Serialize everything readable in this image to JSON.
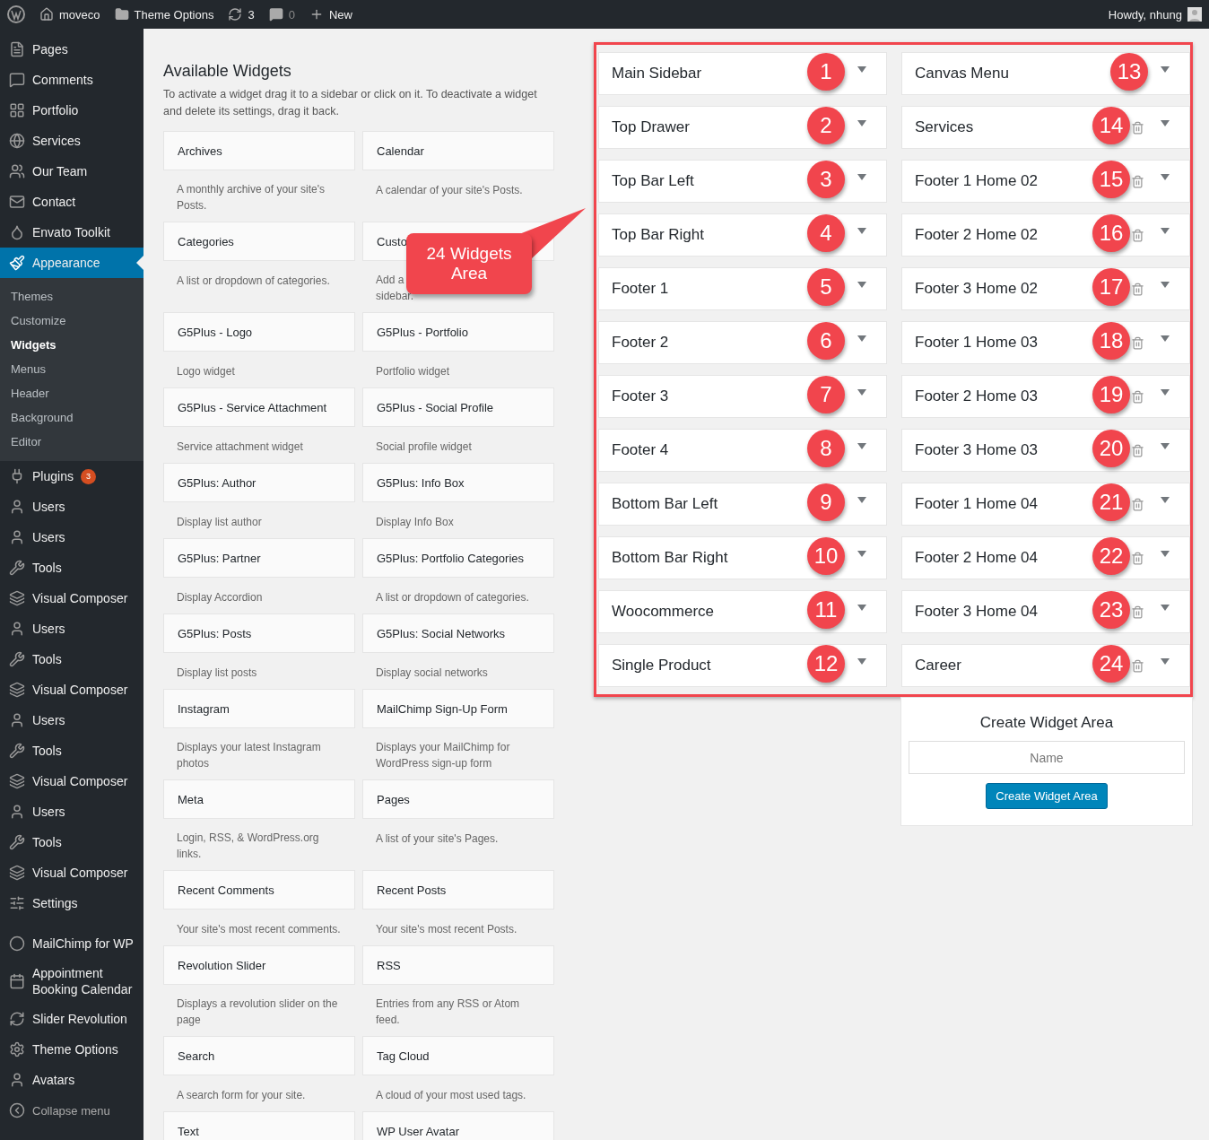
{
  "admin_bar": {
    "site": "moveco",
    "theme_options": "Theme Options",
    "updates": "3",
    "comments": "0",
    "new": "New",
    "greeting": "Howdy, nhung"
  },
  "sidebar": {
    "items": [
      {
        "label": "Pages",
        "selected": false
      },
      {
        "label": "Comments",
        "selected": false
      },
      {
        "label": "Portfolio",
        "selected": false
      },
      {
        "label": "Services",
        "selected": false
      },
      {
        "label": "Our Team",
        "selected": false
      },
      {
        "label": "Contact",
        "selected": false
      },
      {
        "label": "Envato Toolkit",
        "selected": false
      },
      {
        "label": "Appearance",
        "selected": true,
        "children": [
          {
            "label": "Themes",
            "selected": false
          },
          {
            "label": "Customize",
            "selected": false
          },
          {
            "label": "Widgets",
            "selected": true
          },
          {
            "label": "Menus",
            "selected": false
          },
          {
            "label": "Header",
            "selected": false
          },
          {
            "label": "Background",
            "selected": false
          },
          {
            "label": "Editor",
            "selected": false
          }
        ]
      },
      {
        "label": "Plugins",
        "selected": false,
        "badge": "3"
      },
      {
        "label": "Users",
        "selected": false
      },
      {
        "label": "Users",
        "selected": false
      },
      {
        "label": "Tools",
        "selected": false
      },
      {
        "label": "Visual Composer",
        "selected": false
      },
      {
        "label": "Users",
        "selected": false
      },
      {
        "label": "Tools",
        "selected": false
      },
      {
        "label": "Visual Composer",
        "selected": false
      },
      {
        "label": "Users",
        "selected": false
      },
      {
        "label": "Tools",
        "selected": false
      },
      {
        "label": "Visual Composer",
        "selected": false
      },
      {
        "label": "Users",
        "selected": false
      },
      {
        "label": "Tools",
        "selected": false
      },
      {
        "label": "Visual Composer",
        "selected": false
      },
      {
        "label": "Settings",
        "selected": false
      },
      {
        "label": "MailChimp for WP",
        "selected": false,
        "separator_before": true
      },
      {
        "label": "Appointment Booking Calendar",
        "selected": false
      },
      {
        "label": "Slider Revolution",
        "selected": false
      },
      {
        "label": "Theme Options",
        "selected": false
      },
      {
        "label": "Avatars",
        "selected": false
      }
    ],
    "collapse": "Collapse menu"
  },
  "available_widgets": {
    "title": "Available Widgets",
    "description": "To activate a widget drag it to a sidebar or click on it. To deactivate a widget and delete its settings, drag it back.",
    "widgets": [
      {
        "name": "Archives",
        "description": "A monthly archive of your site's Posts."
      },
      {
        "name": "Calendar",
        "description": "A calendar of your site's Posts."
      },
      {
        "name": "Categories",
        "description": "A list or dropdown of categories."
      },
      {
        "name": "Custo",
        "description": "Add a\nsidebar."
      },
      {
        "name": "G5Plus - Logo",
        "description": "Logo widget"
      },
      {
        "name": "G5Plus - Portfolio",
        "description": "Portfolio widget"
      },
      {
        "name": "G5Plus - Service Attachment",
        "description": "Service attachment widget"
      },
      {
        "name": "G5Plus - Social Profile",
        "description": "Social profile widget"
      },
      {
        "name": "G5Plus: Author",
        "description": "Display list author"
      },
      {
        "name": "G5Plus: Info Box",
        "description": "Display Info Box"
      },
      {
        "name": "G5Plus: Partner",
        "description": "Display Accordion"
      },
      {
        "name": "G5Plus: Portfolio Categories",
        "description": "A list or dropdown of categories."
      },
      {
        "name": "G5Plus: Posts",
        "description": "Display list posts"
      },
      {
        "name": "G5Plus: Social Networks",
        "description": "Display social networks"
      },
      {
        "name": "Instagram",
        "description": "Displays your latest Instagram photos"
      },
      {
        "name": "MailChimp Sign-Up Form",
        "description": "Displays your MailChimp for WordPress sign-up form"
      },
      {
        "name": "Meta",
        "description": "Login, RSS, & WordPress.org links."
      },
      {
        "name": "Pages",
        "description": "A list of your site's Pages."
      },
      {
        "name": "Recent Comments",
        "description": "Your site's most recent comments."
      },
      {
        "name": "Recent Posts",
        "description": "Your site's most recent Posts."
      },
      {
        "name": "Revolution Slider",
        "description": "Displays a revolution slider on the page"
      },
      {
        "name": "RSS",
        "description": "Entries from any RSS or Atom feed."
      },
      {
        "name": "Search",
        "description": "A search form for your site."
      },
      {
        "name": "Tag Cloud",
        "description": "A cloud of your most used tags."
      },
      {
        "name": "Text"
      },
      {
        "name": "WP User Avatar"
      }
    ]
  },
  "callout": "24 Widgets\nArea",
  "widget_areas": {
    "columns": [
      [
        {
          "name": "Main Sidebar",
          "number": "1",
          "deletable": false
        },
        {
          "name": "Top Drawer",
          "number": "2",
          "deletable": false
        },
        {
          "name": "Top Bar Left",
          "number": "3",
          "deletable": false
        },
        {
          "name": "Top Bar Right",
          "number": "4",
          "deletable": false
        },
        {
          "name": "Footer 1",
          "number": "5",
          "deletable": false
        },
        {
          "name": "Footer 2",
          "number": "6",
          "deletable": false
        },
        {
          "name": "Footer 3",
          "number": "7",
          "deletable": false
        },
        {
          "name": "Footer 4",
          "number": "8",
          "deletable": false
        },
        {
          "name": "Bottom Bar Left",
          "number": "9",
          "deletable": false
        },
        {
          "name": "Bottom Bar Right",
          "number": "10",
          "deletable": false
        },
        {
          "name": "Woocommerce",
          "number": "11",
          "deletable": false
        },
        {
          "name": "Single Product",
          "number": "12",
          "deletable": false
        }
      ],
      [
        {
          "name": "Canvas Menu",
          "number": "13",
          "deletable": false
        },
        {
          "name": "Services",
          "number": "14",
          "deletable": true
        },
        {
          "name": "Footer 1 Home 02",
          "number": "15",
          "deletable": true
        },
        {
          "name": "Footer 2 Home 02",
          "number": "16",
          "deletable": true
        },
        {
          "name": "Footer 3 Home 02",
          "number": "17",
          "deletable": true
        },
        {
          "name": "Footer 1 Home 03",
          "number": "18",
          "deletable": true
        },
        {
          "name": "Footer 2 Home 03",
          "number": "19",
          "deletable": true
        },
        {
          "name": "Footer 3 Home 03",
          "number": "20",
          "deletable": true
        },
        {
          "name": "Footer 1 Home 04",
          "number": "21",
          "deletable": true
        },
        {
          "name": "Footer 2 Home 04",
          "number": "22",
          "deletable": true
        },
        {
          "name": "Footer 3 Home 04",
          "number": "23",
          "deletable": true
        },
        {
          "name": "Career",
          "number": "24",
          "deletable": true
        }
      ]
    ]
  },
  "create_widget_area": {
    "title": "Create Widget Area",
    "placeholder": "Name",
    "button": "Create Widget Area"
  }
}
